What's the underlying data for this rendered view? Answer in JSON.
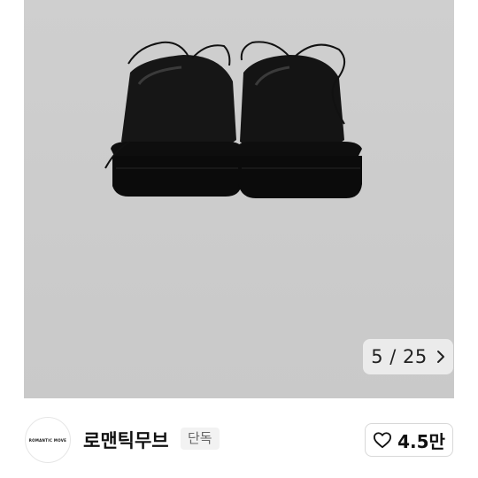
{
  "gallery": {
    "image_alt": "black leather shoes rear view",
    "counter": "5 / 25",
    "next_icon": "chevron-right-icon"
  },
  "store": {
    "logo_text": "ROMANTIC MOVE",
    "name": "로맨틱무브",
    "badge": "단독",
    "like_icon": "heart-outline-icon",
    "like_count": "4.5만"
  },
  "colors": {
    "photo_bg": "#cbcbcb",
    "counter_bg": "#ebebeb",
    "badge_bg": "#f2f2f2"
  }
}
